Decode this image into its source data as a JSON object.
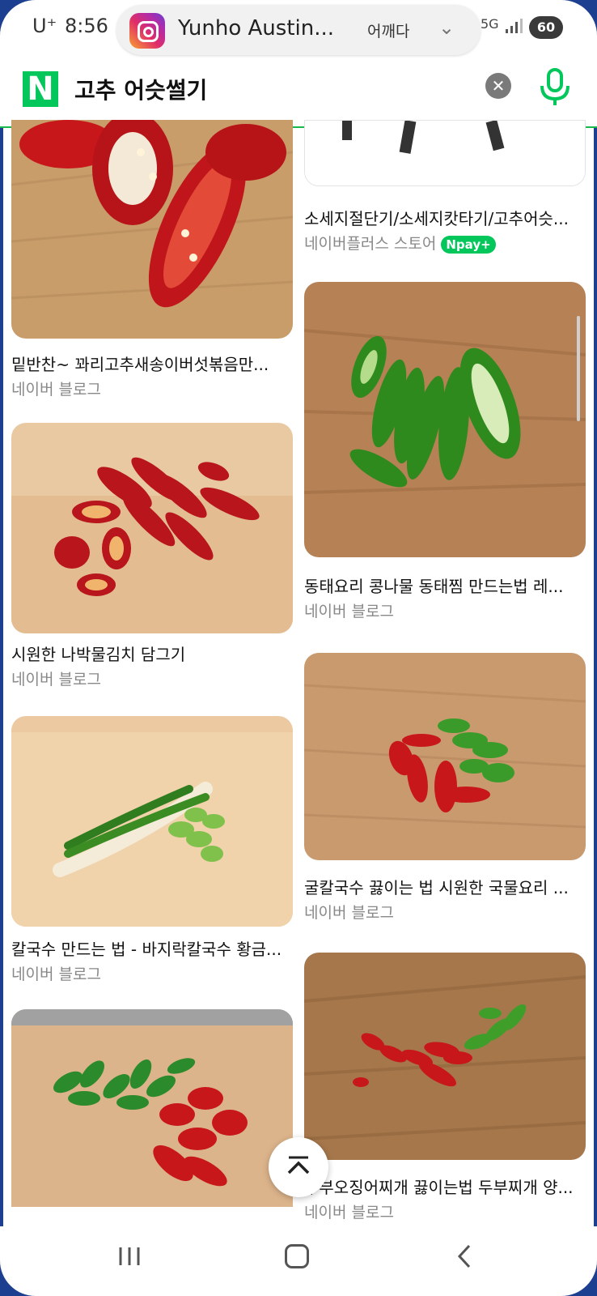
{
  "status_bar": {
    "carrier": "U⁺",
    "time": "8:56",
    "notification": {
      "app_icon": "instagram-icon",
      "name": "Yunho Austin...",
      "message": "어깨다"
    },
    "network": "5G",
    "battery": "60"
  },
  "search": {
    "logo": "N",
    "query": "고추 어슷썰기",
    "clear_icon": "close-icon",
    "voice_icon": "mic-icon"
  },
  "results": {
    "left": [
      {
        "title": "밑반찬~ 꽈리고추새송이버섯볶음만...",
        "source": "네이버 블로그"
      },
      {
        "title": "시원한 나박물김치 담그기",
        "source": "네이버 블로그"
      },
      {
        "title": "칼국수 만드는 법 - 바지락칼국수 황금...",
        "source": "네이버 블로그"
      },
      {
        "title": "",
        "source": ""
      }
    ],
    "right": [
      {
        "title": "소세지절단기/소세지캇타기/고추어슷...",
        "source": "네이버플러스 스토어",
        "badge": "Npay+"
      },
      {
        "title": "동태요리 콩나물 동태찜 만드는법 레...",
        "source": "네이버 블로그"
      },
      {
        "title": "굴칼국수 끓이는 법 시원한 국물요리 ...",
        "source": "네이버 블로그"
      },
      {
        "title": "두부오징어찌개 끓이는법 두부찌개 양...",
        "source": "네이버 블로그"
      }
    ]
  },
  "scroll_top_icon": "chevron-up-icon",
  "nav": {
    "recent_icon": "recent-apps-icon",
    "home_icon": "home-icon",
    "back_icon": "back-icon"
  },
  "colors": {
    "naver_green": "#03c75a",
    "frame_blue": "#1d3f8f"
  }
}
